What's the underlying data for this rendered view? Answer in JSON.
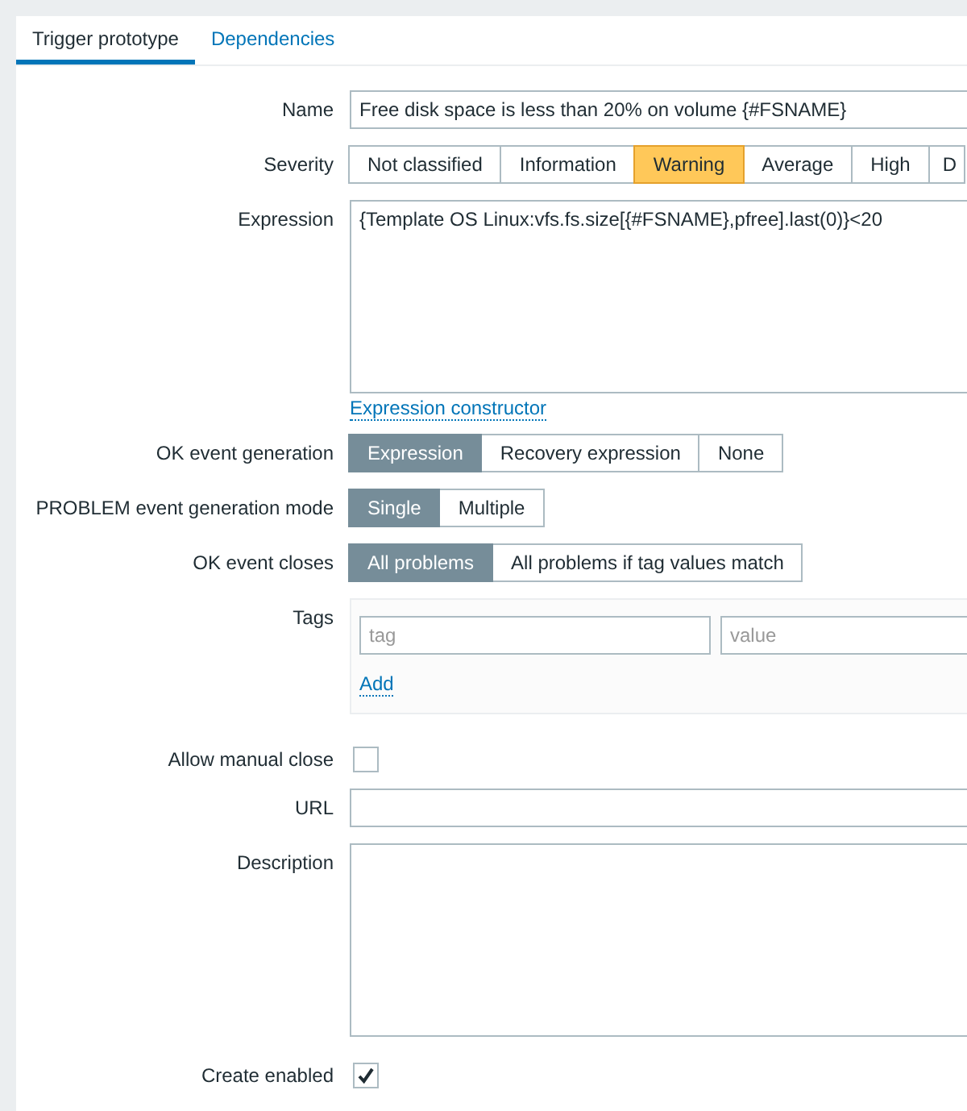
{
  "tabs": [
    {
      "label": "Trigger prototype",
      "selected": true
    },
    {
      "label": "Dependencies",
      "selected": false
    }
  ],
  "form": {
    "name": {
      "label": "Name",
      "value": "Free disk space is less than 20% on volume {#FSNAME}"
    },
    "severity": {
      "label": "Severity",
      "kind": "severity",
      "options": [
        {
          "label": "Not classified",
          "selected": false
        },
        {
          "label": "Information",
          "selected": false
        },
        {
          "label": "Warning",
          "selected": true
        },
        {
          "label": "Average",
          "selected": false
        },
        {
          "label": "High",
          "selected": false
        },
        {
          "label": "D",
          "selected": false
        }
      ]
    },
    "expression": {
      "label": "Expression",
      "value": "{Template OS Linux:vfs.fs.size[{#FSNAME},pfree].last(0)}<20",
      "link": "Expression constructor"
    },
    "ok_event_generation": {
      "label": "OK event generation",
      "kind": "choice",
      "options": [
        {
          "label": "Expression",
          "selected": true
        },
        {
          "label": "Recovery expression",
          "selected": false
        },
        {
          "label": "None",
          "selected": false
        }
      ]
    },
    "problem_event_generation_mode": {
      "label": "PROBLEM event generation mode",
      "kind": "choice",
      "options": [
        {
          "label": "Single",
          "selected": true
        },
        {
          "label": "Multiple",
          "selected": false
        }
      ]
    },
    "ok_event_closes": {
      "label": "OK event closes",
      "kind": "choice",
      "options": [
        {
          "label": "All problems",
          "selected": true
        },
        {
          "label": "All problems if tag values match",
          "selected": false
        }
      ]
    },
    "tags": {
      "label": "Tags",
      "tag_field": {
        "placeholder": "tag"
      },
      "value_field": {
        "placeholder": "value"
      },
      "add": "Add"
    },
    "allow_manual_close": {
      "label": "Allow manual close",
      "checked": false
    },
    "url": {
      "label": "URL"
    },
    "description": {
      "label": "Description"
    },
    "create_enabled": {
      "label": "Create enabled",
      "checked": true
    }
  }
}
